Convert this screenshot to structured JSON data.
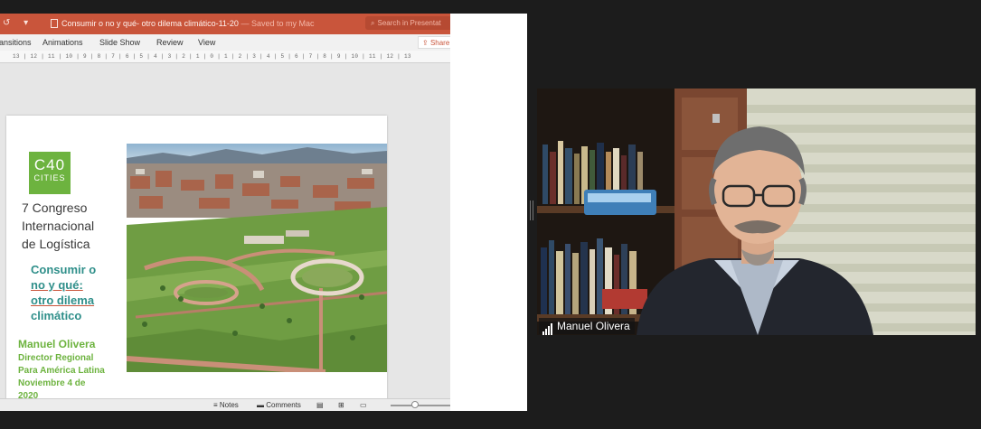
{
  "powerpoint": {
    "title": "Consumir o no y qué- otro dilema climático-11-20",
    "saved": "— Saved to my Mac",
    "search_placeholder": "Search in Presentat",
    "ribbon_tabs": [
      "ansitions",
      "Animations",
      "Slide Show",
      "Review",
      "View"
    ],
    "share_label": "Share",
    "ruler": "13 | 12 | 11 | 10 | 9 | 8 | 7 | 6 | 5 | 4 | 3 | 2 | 1 | 0 | 1 | 2 | 3 | 4 | 5 | 6 | 7 | 8 | 9 | 10 | 11 | 12 | 13",
    "status": {
      "notes": "Notes",
      "comments": "Comments"
    },
    "accent_color": "#c9553b"
  },
  "slide": {
    "logo_line1": "C40",
    "logo_line2": "CITIES",
    "congress": [
      "7 Congreso",
      "Internacional",
      "de Logística"
    ],
    "topic": [
      "Consumir o",
      "no y qué:",
      "otro dilema",
      "climático"
    ],
    "author": "Manuel Olivera",
    "author_lines": [
      "Director Regional",
      "Para América Latina",
      "Noviembre 4 de",
      "2020"
    ],
    "brand_green": "#6db33f",
    "topic_teal": "#2f8f8a"
  },
  "video": {
    "participant_name": "Manuel Olivera"
  }
}
